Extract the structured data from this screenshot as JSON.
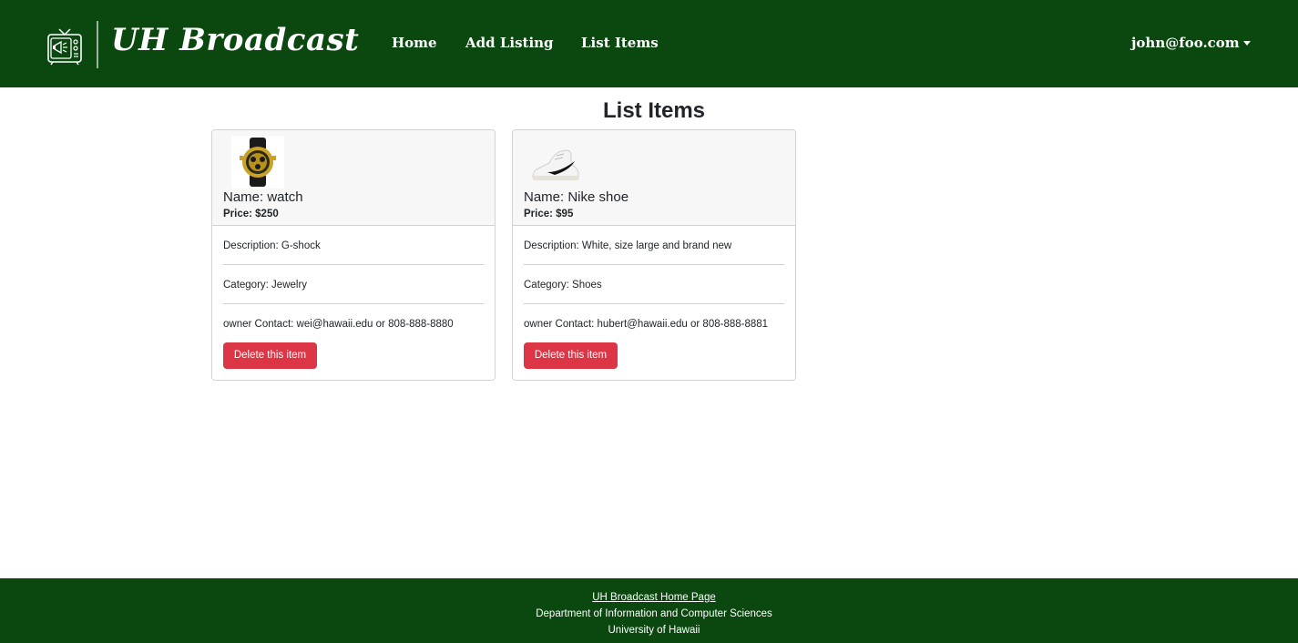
{
  "navbar": {
    "brand": "UH Broadcast",
    "logo_icon": "tv-megaphone-icon",
    "links": [
      {
        "label": "Home"
      },
      {
        "label": "Add Listing"
      },
      {
        "label": "List Items"
      }
    ],
    "user": "john@foo.com"
  },
  "page": {
    "title": "List Items"
  },
  "items": [
    {
      "image_icon": "watch-image",
      "name": "Name: watch",
      "price": "Price: $250",
      "description": "Description: G-shock",
      "category": "Category: Jewelry",
      "contact": "owner Contact: wei@hawaii.edu or 808-888-8880",
      "delete_label": "Delete this item"
    },
    {
      "image_icon": "shoe-image",
      "name": "Name: Nike shoe",
      "price": "Price: $95",
      "description": "Description: White, size large and brand new",
      "category": "Category: Shoes",
      "contact": "owner Contact: hubert@hawaii.edu or 808-888-8881",
      "delete_label": "Delete this item"
    }
  ],
  "footer": {
    "link": "UH Broadcast Home Page",
    "department": "Department of Information and Computer Sciences",
    "university": "University of Hawaii"
  },
  "colors": {
    "brand_green": "#0b4810",
    "danger": "#dc3545",
    "card_header": "#f7f7f7"
  }
}
